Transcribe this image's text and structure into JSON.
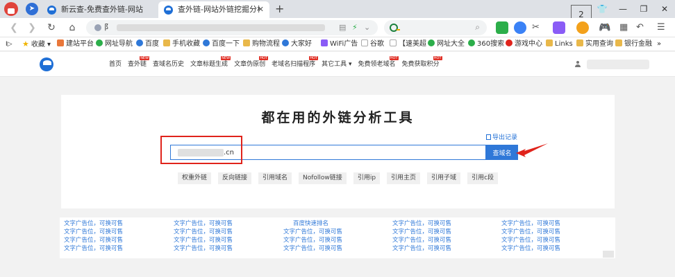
{
  "browser": {
    "tabs": [
      {
        "title": "新云查-免费查外链-网站域名查",
        "active": false
      },
      {
        "title": "查外链-网站外链挖掘分析-新云",
        "active": true
      }
    ],
    "tab_close": "✕",
    "new_tab": "+",
    "tab_count": "2",
    "url": "阝",
    "search_placeholder": ""
  },
  "bookmarks": [
    {
      "label": "收藏",
      "icon": "star-icon"
    },
    {
      "label": "建站平台",
      "icon": "site-icon"
    },
    {
      "label": "网址导航",
      "icon": "nav-icon"
    },
    {
      "label": "百度",
      "icon": "baidu-icon"
    },
    {
      "label": "手机收藏",
      "icon": "folder-icon"
    },
    {
      "label": "百度一下",
      "icon": "baidu-icon"
    },
    {
      "label": "购物流程",
      "icon": "folder-icon"
    },
    {
      "label": "大家好",
      "icon": "wave-icon"
    },
    {
      "label": "WiFi广告",
      "icon": "wifi-icon"
    },
    {
      "label": "谷歌",
      "icon": "page-icon"
    },
    {
      "label": "【速美超",
      "icon": "page-icon"
    },
    {
      "label": "网址大全",
      "icon": "nav-icon"
    },
    {
      "label": "360搜索",
      "icon": "search360-icon"
    },
    {
      "label": "游戏中心",
      "icon": "game-icon"
    },
    {
      "label": "Links",
      "icon": "folder-icon"
    },
    {
      "label": "实用查询",
      "icon": "folder-icon"
    },
    {
      "label": "银行金融",
      "icon": "folder-icon"
    }
  ],
  "bookmarks_more": "»",
  "site_nav": [
    {
      "label": "首页",
      "hot": ""
    },
    {
      "label": "查外链",
      "hot": "NEW"
    },
    {
      "label": "查域名历史",
      "hot": ""
    },
    {
      "label": "文章标题生成",
      "hot": "NEW"
    },
    {
      "label": "文章伪原创",
      "hot": "HOT"
    },
    {
      "label": "老域名扫描程序",
      "hot": "HOT"
    },
    {
      "label": "其它工具 ▾",
      "hot": ""
    },
    {
      "label": "免费领老域名",
      "hot": "HOT"
    },
    {
      "label": "免费获取积分",
      "hot": "HOT"
    }
  ],
  "main": {
    "title": "都在用的外链分析工具",
    "export_label": "导出记录",
    "search_value": ".cn",
    "search_button": "查域名",
    "chips": [
      "权重外链",
      "反向链接",
      "引用域名",
      "Nofollow链接",
      "引用ip",
      "引用主页",
      "引用子域",
      "引用c段"
    ]
  },
  "ads": {
    "columns": [
      [
        "文字广告位，可换可售",
        "文字广告位，可换可售",
        "文字广告位，可换可售",
        "文字广告位，可换可售"
      ],
      [
        "文字广告位，可换可售",
        "文字广告位，可换可售",
        "文字广告位，可换可售",
        "文字广告位，可换可售"
      ],
      [
        "百度快速排名",
        "文字广告位，可换可售",
        "文字广告位，可换可售",
        "文字广告位，可换可售"
      ],
      [
        "文字广告位，可换可售",
        "文字广告位，可换可售",
        "文字广告位，可换可售",
        "文字广告位，可换可售"
      ],
      [
        "文字广告位，可换可售",
        "文字广告位，可换可售",
        "文字广告位，可换可售",
        "文字广告位，可换可售"
      ]
    ]
  },
  "colors": {
    "accent": "#2f78d8",
    "highlight": "#e0231b",
    "hot_badge": "#e02e24"
  }
}
